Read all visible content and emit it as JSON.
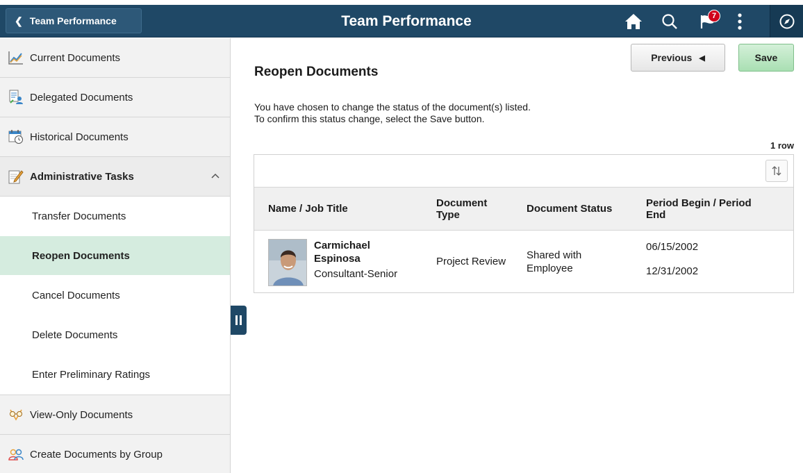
{
  "header": {
    "back_label": "Team Performance",
    "page_title": "Team Performance",
    "notifications_count": "7"
  },
  "sidebar": {
    "items": [
      {
        "label": "Current Documents",
        "icon": "line-chart-icon"
      },
      {
        "label": "Delegated Documents",
        "icon": "delegate-icon"
      },
      {
        "label": "Historical Documents",
        "icon": "calendar-clock-icon"
      }
    ],
    "section": {
      "label": "Administrative Tasks",
      "icon": "notepad-pencil-icon",
      "expanded": true,
      "subitems": [
        {
          "label": "Transfer Documents"
        },
        {
          "label": "Reopen Documents"
        },
        {
          "label": "Cancel  Documents"
        },
        {
          "label": "Delete Documents"
        },
        {
          "label": "Enter Preliminary Ratings"
        }
      ]
    },
    "bottom_items": [
      {
        "label": "View-Only Documents",
        "icon": "glasses-icon"
      },
      {
        "label": "Create Documents by Group",
        "icon": "group-icon"
      }
    ]
  },
  "main": {
    "previous_label": "Previous",
    "save_label": "Save",
    "title": "Reopen Documents",
    "message_line1": "You have chosen to change the status of the document(s) listed.",
    "message_line2": "To confirm this status change, select the Save button.",
    "row_count": "1 row",
    "columns": {
      "name": "Name / Job Title",
      "doc_type_1": "Document",
      "doc_type_2": "Type",
      "doc_status": "Document Status",
      "period_1": "Period Begin / Period",
      "period_2": "End"
    },
    "rows": [
      {
        "name_1": "Carmichael",
        "name_2": "Espinosa",
        "job_title": "Consultant-Senior",
        "doc_type": "Project Review",
        "status_1": "Shared with",
        "status_2": "Employee",
        "period_begin": "06/15/2002",
        "period_end": "12/31/2002"
      }
    ]
  },
  "colors": {
    "header_bg": "#1f4866",
    "active_item_bg": "#d5ecdf",
    "save_button_bg": "#a9dfb3",
    "badge_bg": "#d0021b"
  }
}
